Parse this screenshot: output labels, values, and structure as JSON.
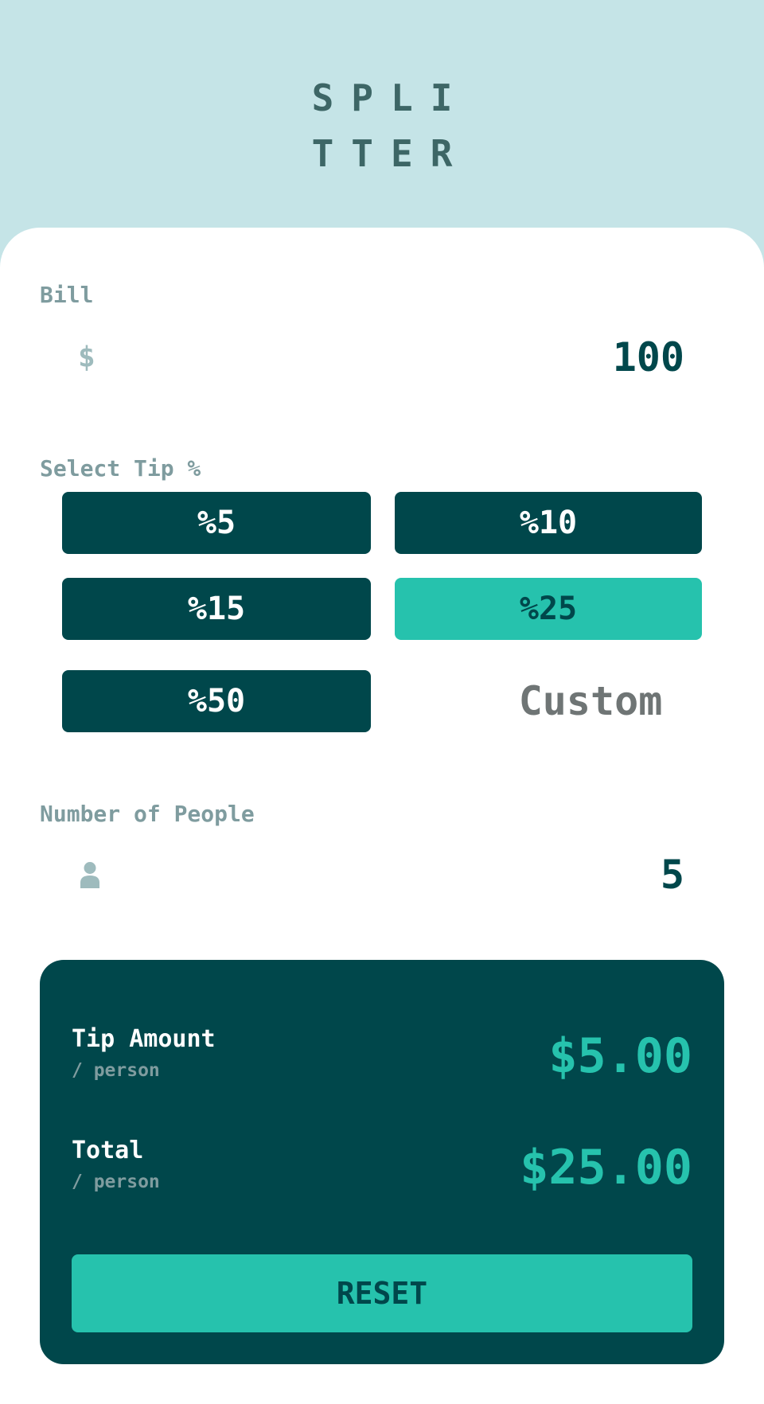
{
  "logo": {
    "line1": "SPLI",
    "line2": "TTER"
  },
  "bill": {
    "label": "Bill",
    "currency_icon": "$",
    "value": "100"
  },
  "tip": {
    "label": "Select Tip %",
    "options": [
      {
        "label": "%5",
        "selected": false
      },
      {
        "label": "%10",
        "selected": false
      },
      {
        "label": "%15",
        "selected": false
      },
      {
        "label": "%25",
        "selected": true
      },
      {
        "label": "%50",
        "selected": false
      }
    ],
    "custom_placeholder": "Custom"
  },
  "people": {
    "label": "Number of People",
    "icon": "person-icon",
    "value": "5"
  },
  "result": {
    "tip_amount": {
      "title": "Tip Amount",
      "sub": "/ person",
      "value": "$5.00"
    },
    "total": {
      "title": "Total",
      "sub": "/ person",
      "value": "$25.00"
    },
    "reset_label": "RESET"
  },
  "colors": {
    "background": "#c5e4e7",
    "dark_cyan": "#00474b",
    "strong_cyan": "#26c2ad",
    "label_grey": "#7f9c9f"
  }
}
